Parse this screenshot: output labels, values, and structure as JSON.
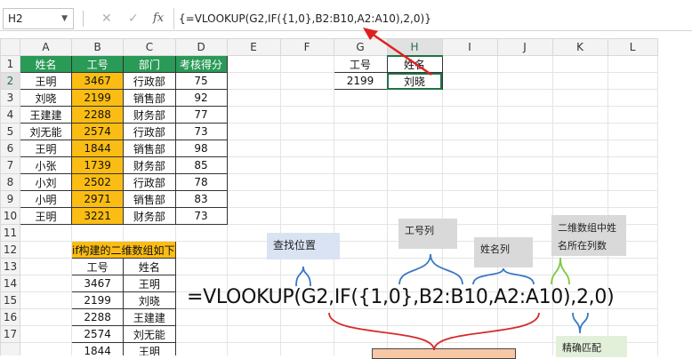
{
  "formula_bar": {
    "name_box": "H2",
    "cancel_icon": "✕",
    "enter_icon": "✓",
    "fx_icon": "fx",
    "formula": "{=VLOOKUP(G2,IF({1,0},B2:B10,A2:A10),2,0)}"
  },
  "columns": [
    "A",
    "B",
    "C",
    "D",
    "E",
    "F",
    "G",
    "H",
    "I",
    "J",
    "K",
    "L"
  ],
  "rows": [
    "1",
    "2",
    "3",
    "4",
    "5",
    "6",
    "7",
    "8",
    "9",
    "10",
    "11",
    "12",
    "13",
    "14",
    "15",
    "16",
    "17"
  ],
  "main_table": {
    "headers": [
      "姓名",
      "工号",
      "部门",
      "考核得分"
    ],
    "rows": [
      [
        "王明",
        "3467",
        "行政部",
        "75"
      ],
      [
        "刘晓",
        "2199",
        "销售部",
        "92"
      ],
      [
        "王建建",
        "2288",
        "财务部",
        "77"
      ],
      [
        "刘无能",
        "2574",
        "行政部",
        "73"
      ],
      [
        "王明",
        "1844",
        "销售部",
        "98"
      ],
      [
        "小张",
        "1739",
        "财务部",
        "85"
      ],
      [
        "小刘",
        "2502",
        "行政部",
        "78"
      ],
      [
        "小明",
        "2971",
        "销售部",
        "83"
      ],
      [
        "王明",
        "3221",
        "财务部",
        "73"
      ]
    ]
  },
  "lookup_table": {
    "headers": [
      "工号",
      "姓名"
    ],
    "row": [
      "2199",
      "刘晓"
    ]
  },
  "array_table": {
    "title": "if构建的二维数组如下",
    "headers": [
      "工号",
      "姓名"
    ],
    "rows": [
      [
        "3467",
        "王明"
      ],
      [
        "2199",
        "刘晓"
      ],
      [
        "2288",
        "王建建"
      ],
      [
        "2574",
        "刘无能"
      ],
      [
        "1844",
        "王明"
      ]
    ]
  },
  "big_formula": "=VLOOKUP(G2,IF({1,0},B2:B10,A2:A10),2,0)",
  "callouts": {
    "find_position": "查找位置",
    "id_column": "工号列",
    "name_column": "姓名列",
    "column_number": "二维数组中姓名所在列数",
    "exact_match": "精确匹配"
  },
  "colors": {
    "header_green": "#2a9a57",
    "gold": "#fbbd14",
    "arrow_red": "#e02020",
    "brace_blue": "#3a78c4",
    "brace_red": "#d62a2a",
    "brace_green": "#7ac943",
    "callout_blue": "#dae3f3",
    "callout_gray": "#d9d9d9",
    "callout_green": "#e2f0d9"
  }
}
